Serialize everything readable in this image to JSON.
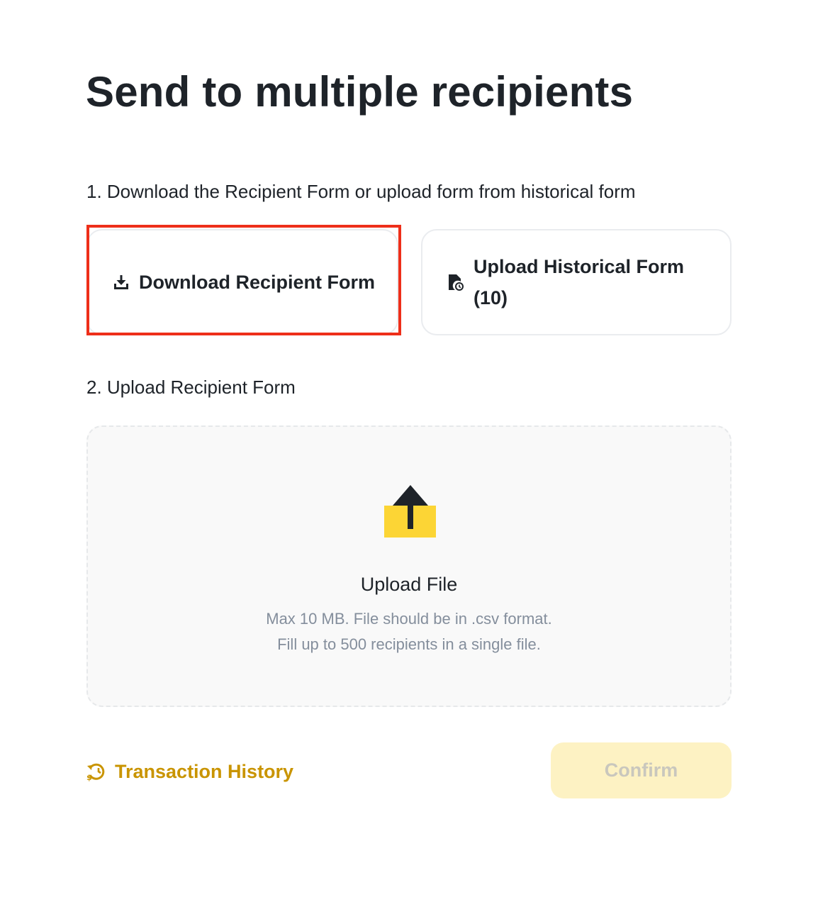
{
  "page": {
    "title": "Send to multiple recipients"
  },
  "steps": {
    "step1_label": "1. Download the Recipient Form or upload form from historical form",
    "step2_label": "2. Upload Recipient Form"
  },
  "options": {
    "download": {
      "label": "Download Recipient Form",
      "icon": "download-icon",
      "highlighted": true
    },
    "history": {
      "label": "Upload Historical Form (10)",
      "icon": "file-clock-icon"
    }
  },
  "upload": {
    "icon": "upload-file-icon",
    "title": "Upload File",
    "hint_line1": "Max 10 MB. File should be in .csv format.",
    "hint_line2": "Fill up to 500 recipients in a single file."
  },
  "footer": {
    "history_link_label": "Transaction History",
    "history_icon": "history-dollar-icon",
    "confirm_label": "Confirm",
    "confirm_disabled": true
  },
  "colors": {
    "text_primary": "#1e2329",
    "text_secondary": "#848e9c",
    "brand_gold": "#c99400",
    "brand_yellow": "#fcd535",
    "confirm_bg_disabled": "#fdf2c3",
    "highlight_red": "#ee2f1a",
    "card_border": "#eaecef"
  }
}
